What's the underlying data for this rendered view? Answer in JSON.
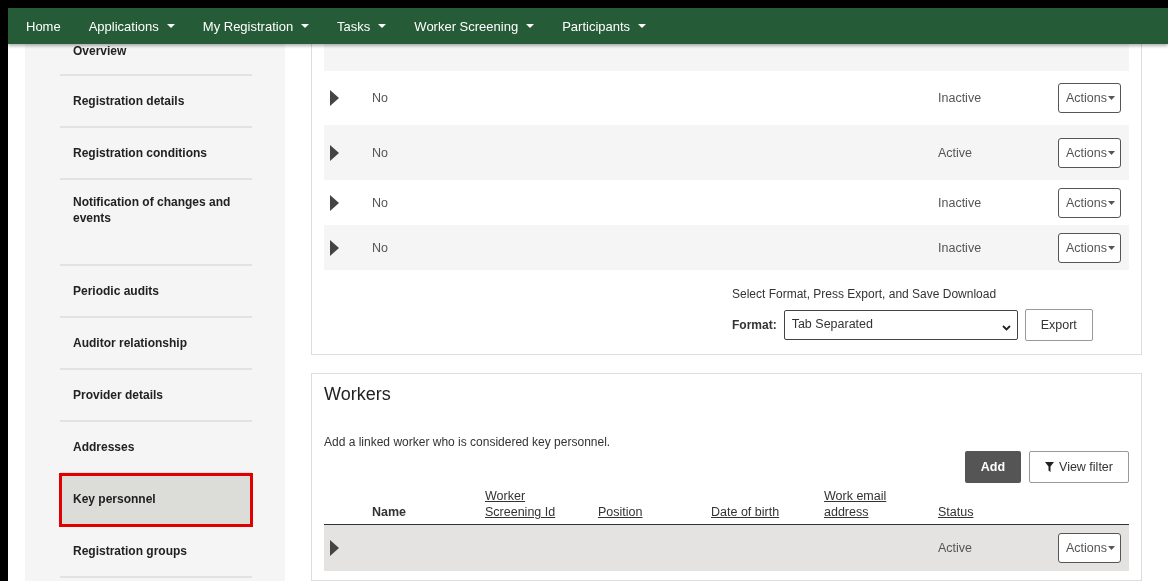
{
  "nav": [
    {
      "label": "Home",
      "dropdown": false
    },
    {
      "label": "Applications",
      "dropdown": true
    },
    {
      "label": "My Registration",
      "dropdown": true
    },
    {
      "label": "Tasks",
      "dropdown": true
    },
    {
      "label": "Worker Screening",
      "dropdown": true
    },
    {
      "label": "Participants",
      "dropdown": true
    }
  ],
  "sidebar": {
    "items": [
      {
        "label": "Overview",
        "selected": false
      },
      {
        "label": "Registration details",
        "selected": false
      },
      {
        "label": "Registration conditions",
        "selected": false
      },
      {
        "label": "Notification of changes and events",
        "selected": false
      },
      {
        "label": "Periodic audits",
        "selected": false
      },
      {
        "label": "Auditor relationship",
        "selected": false
      },
      {
        "label": "Provider details",
        "selected": false
      },
      {
        "label": "Addresses",
        "selected": false
      },
      {
        "label": "Key personnel",
        "selected": true
      },
      {
        "label": "Registration groups",
        "selected": false
      }
    ]
  },
  "upper_table": {
    "rows": [
      {
        "column_1": "No",
        "status": "Inactive",
        "action": "Actions"
      },
      {
        "column_1": "No",
        "status": "Active",
        "action": "Actions"
      },
      {
        "column_1": "No",
        "status": "Inactive",
        "action": "Actions"
      },
      {
        "column_1": "No",
        "status": "Inactive",
        "action": "Actions"
      }
    ],
    "export": {
      "hint": "Select Format, Press Export, and Save Download",
      "format_label": "Format:",
      "format_value": "Tab Separated",
      "button": "Export"
    }
  },
  "workers": {
    "title": "Workers",
    "description": "Add a linked worker who is considered key personnel.",
    "add_button": "Add",
    "filter_button": "View filter",
    "columns": [
      {
        "label": "Name",
        "sortable": false
      },
      {
        "label": "Worker Screening Id",
        "sortable": true
      },
      {
        "label": "Position",
        "sortable": true
      },
      {
        "label": "Date of birth",
        "sortable": true
      },
      {
        "label": "Work email address",
        "sortable": true
      },
      {
        "label": "Status",
        "sortable": true
      }
    ],
    "rows": [
      {
        "status": "Active",
        "action": "Actions",
        "selected": true
      }
    ]
  }
}
